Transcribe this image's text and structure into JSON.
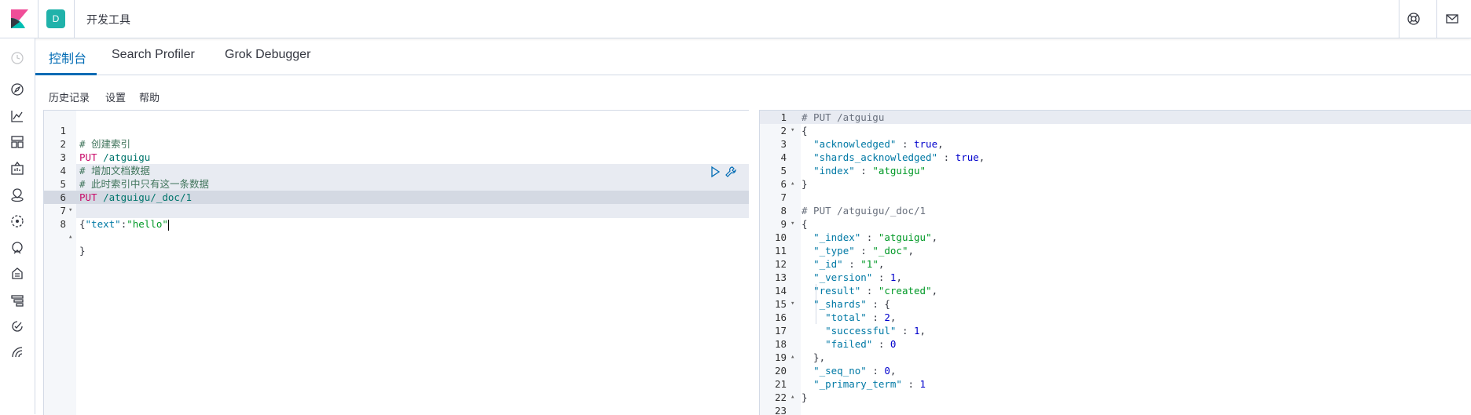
{
  "header": {
    "space_initial": "D",
    "title": "开发工具"
  },
  "tabs": [
    {
      "label": "控制台",
      "active": true
    },
    {
      "label": "Search Profiler",
      "active": false
    },
    {
      "label": "Grok Debugger",
      "active": false
    }
  ],
  "toolbar": {
    "history": "历史记录",
    "settings": "设置",
    "help": "帮助"
  },
  "request_editor": {
    "lines": [
      {
        "n": "1",
        "fold": "",
        "text": "# 创建索引"
      },
      {
        "n": "2",
        "fold": "",
        "text": "PUT /atguigu"
      },
      {
        "n": "3",
        "fold": "",
        "text": "# 增加文档数据"
      },
      {
        "n": "4",
        "fold": "",
        "text": "# 此时索引中只有这一条数据"
      },
      {
        "n": "5",
        "fold": "",
        "text": "PUT /atguigu/_doc/1"
      },
      {
        "n": "6",
        "fold": "▾",
        "text": "{"
      },
      {
        "n": "7",
        "fold": "",
        "text": " \"text\":\"hello\""
      },
      {
        "n": "8",
        "fold": "▴",
        "text": "}"
      }
    ]
  },
  "response_editor": {
    "lines": [
      {
        "n": "1",
        "fold": "",
        "text": "# PUT /atguigu"
      },
      {
        "n": "2",
        "fold": "▾",
        "text": "{"
      },
      {
        "n": "3",
        "fold": "",
        "text": "  \"acknowledged\" : true,"
      },
      {
        "n": "4",
        "fold": "",
        "text": "  \"shards_acknowledged\" : true,"
      },
      {
        "n": "5",
        "fold": "",
        "text": "  \"index\" : \"atguigu\""
      },
      {
        "n": "6",
        "fold": "▴",
        "text": "}"
      },
      {
        "n": "7",
        "fold": "",
        "text": ""
      },
      {
        "n": "8",
        "fold": "",
        "text": "# PUT /atguigu/_doc/1"
      },
      {
        "n": "9",
        "fold": "▾",
        "text": "{"
      },
      {
        "n": "10",
        "fold": "",
        "text": "  \"_index\" : \"atguigu\","
      },
      {
        "n": "11",
        "fold": "",
        "text": "  \"_type\" : \"_doc\","
      },
      {
        "n": "12",
        "fold": "",
        "text": "  \"_id\" : \"1\","
      },
      {
        "n": "13",
        "fold": "",
        "text": "  \"_version\" : 1,"
      },
      {
        "n": "14",
        "fold": "",
        "text": "  \"result\" : \"created\","
      },
      {
        "n": "15",
        "fold": "▾",
        "text": "  \"_shards\" : {"
      },
      {
        "n": "16",
        "fold": "",
        "text": "    \"total\" : 2,"
      },
      {
        "n": "17",
        "fold": "",
        "text": "    \"successful\" : 1,"
      },
      {
        "n": "18",
        "fold": "",
        "text": "    \"failed\" : 0"
      },
      {
        "n": "19",
        "fold": "▴",
        "text": "  },"
      },
      {
        "n": "20",
        "fold": "",
        "text": "  \"_seq_no\" : 0,"
      },
      {
        "n": "21",
        "fold": "",
        "text": "  \"_primary_term\" : 1"
      },
      {
        "n": "22",
        "fold": "▴",
        "text": "}"
      },
      {
        "n": "23",
        "fold": "",
        "text": ""
      }
    ]
  },
  "colors": {
    "accent": "#006bb4",
    "space_avatar": "#20b2aa"
  },
  "icons": {
    "header_right": [
      "help-icon",
      "mail-icon"
    ],
    "nav": [
      "clock-icon",
      "compass-icon",
      "visualize-icon",
      "dashboard-icon",
      "canvas-icon",
      "maps-icon",
      "ml-icon",
      "metrics-icon",
      "logs-icon",
      "apm-icon",
      "uptime-icon",
      "siem-icon",
      "devtools-icon"
    ],
    "editor_actions": [
      "play-icon",
      "wrench-icon"
    ]
  }
}
